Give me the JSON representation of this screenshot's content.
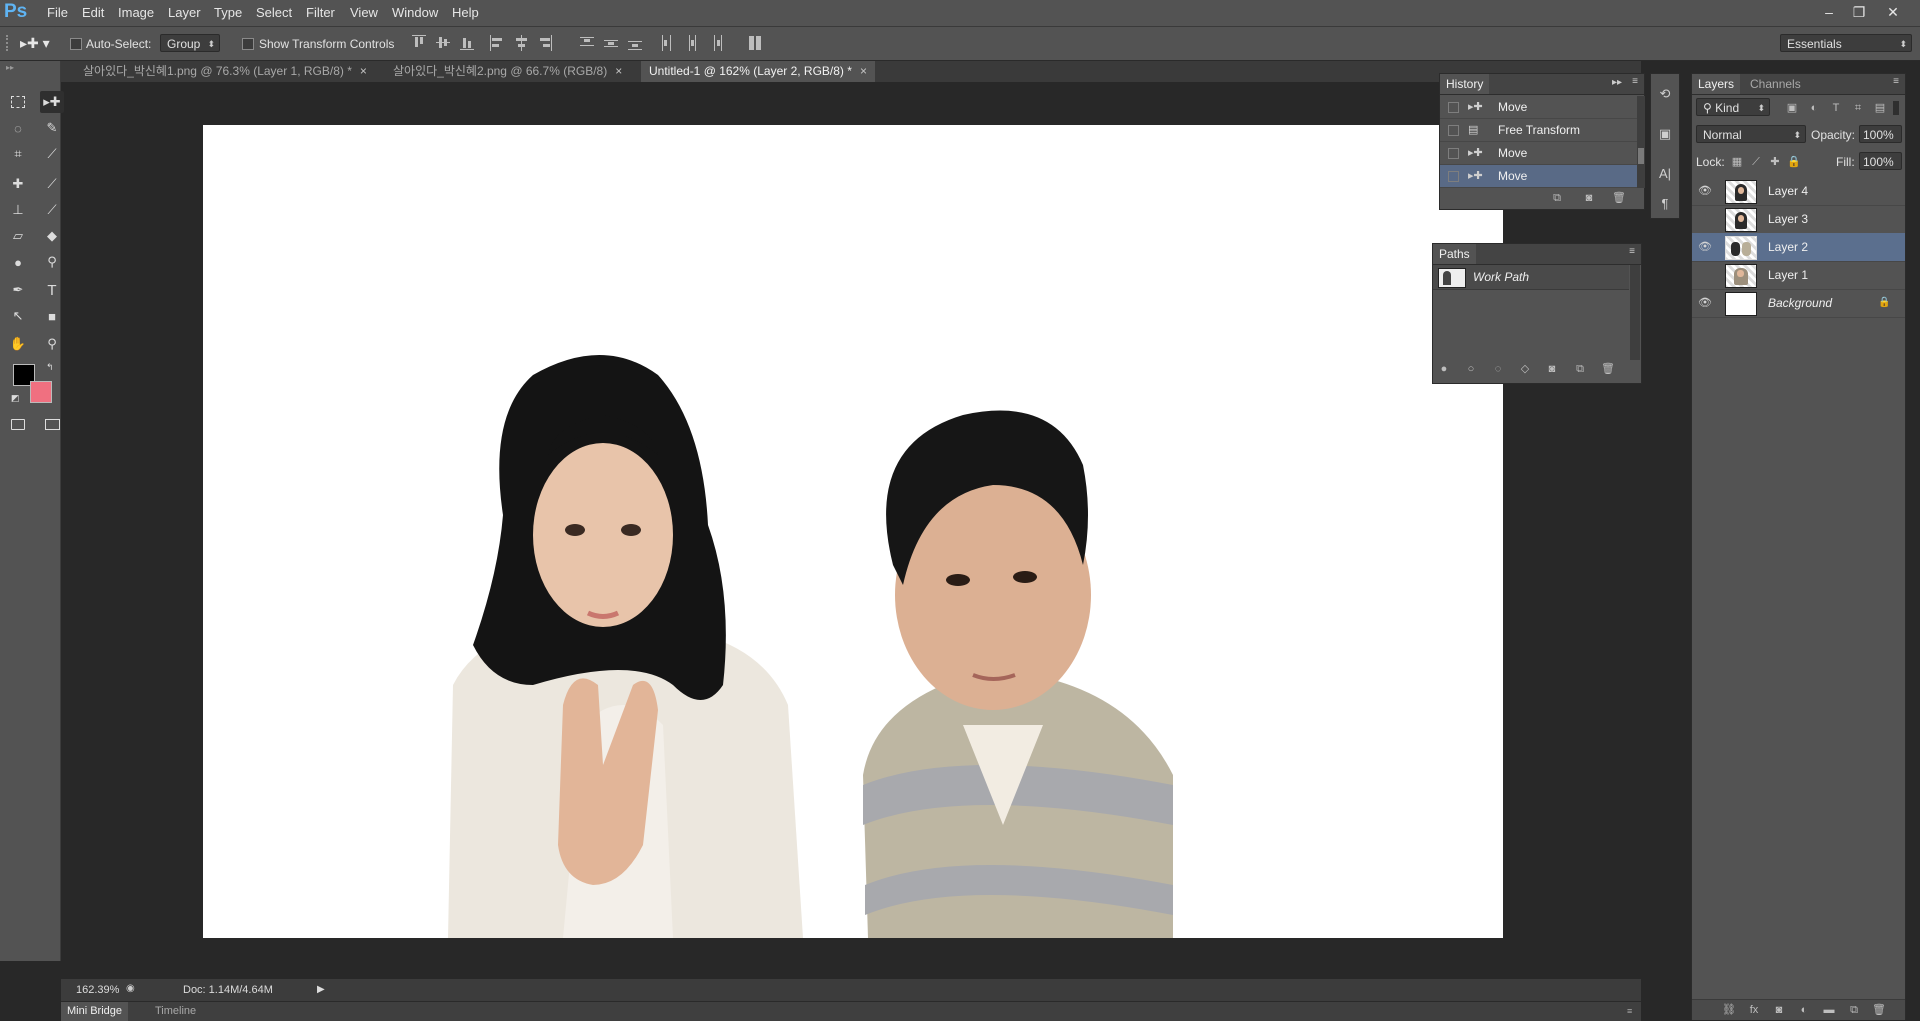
{
  "app": {
    "logo": "Ps",
    "menu": [
      "File",
      "Edit",
      "Image",
      "Layer",
      "Type",
      "Select",
      "Filter",
      "View",
      "Window",
      "Help"
    ],
    "window_controls": [
      "–",
      "❐",
      "✕"
    ]
  },
  "options_bar": {
    "auto_select_label": "Auto-Select:",
    "auto_select_value": "Group",
    "show_transform_label": "Show Transform Controls",
    "workspace": "Essentials"
  },
  "tabs": [
    {
      "label": "살아있다_박신혜1.png @ 76.3% (Layer 1, RGB/8) *",
      "active": false
    },
    {
      "label": "살아있다_박신혜2.png @ 66.7% (RGB/8)",
      "active": false
    },
    {
      "label": "Untitled-1 @ 162% (Layer 2, RGB/8) *",
      "active": true
    }
  ],
  "tab_close": "×",
  "history": {
    "title": "History",
    "items": [
      {
        "label": "Move",
        "selected": false
      },
      {
        "label": "Free Transform",
        "selected": false
      },
      {
        "label": "Move",
        "selected": false
      },
      {
        "label": "Move",
        "selected": true
      }
    ]
  },
  "paths": {
    "title": "Paths",
    "items": [
      "Work Path"
    ]
  },
  "layers": {
    "tab_layers": "Layers",
    "tab_channels": "Channels",
    "kind": "Kind",
    "blend_mode": "Normal",
    "opacity_label": "Opacity:",
    "opacity_value": "100%",
    "lock_label": "Lock:",
    "fill_label": "Fill:",
    "fill_value": "100%",
    "items": [
      {
        "name": "Layer 4",
        "visible": true,
        "selected": false
      },
      {
        "name": "Layer 3",
        "visible": false,
        "selected": false
      },
      {
        "name": "Layer 2",
        "visible": true,
        "selected": true
      },
      {
        "name": "Layer 1",
        "visible": false,
        "selected": false
      },
      {
        "name": "Background",
        "visible": true,
        "selected": false,
        "locked": true
      }
    ]
  },
  "status": {
    "zoom": "162.39%",
    "doc": "Doc: 1.14M/4.64M"
  },
  "bottom_tabs": [
    "Mini Bridge",
    "Timeline"
  ],
  "colors": {
    "foreground": "#000000",
    "background": "#f07080"
  }
}
